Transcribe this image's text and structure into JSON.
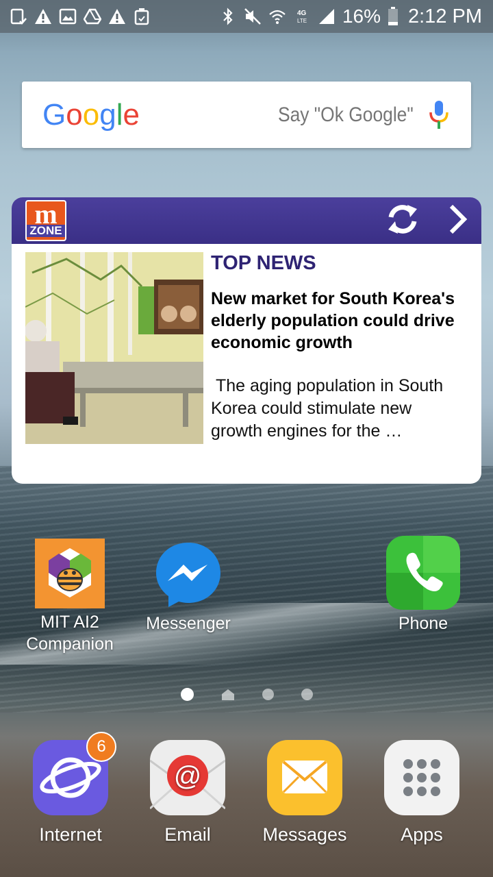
{
  "status_bar": {
    "left_icons": [
      "screenshot-icon",
      "warning-icon",
      "image-icon",
      "drive-icon",
      "warning-icon",
      "cleaner-icon"
    ],
    "right_icons": [
      "bluetooth-icon",
      "mute-icon",
      "wifi-icon",
      "4g-lte-icon",
      "signal-icon"
    ],
    "battery_percent": "16%",
    "time": "2:12 PM"
  },
  "google_widget": {
    "logo_letters": [
      "G",
      "o",
      "o",
      "g",
      "l",
      "e"
    ],
    "hint": "Say \"Ok Google\""
  },
  "news_widget": {
    "logo_m": "m",
    "logo_zone": "ZONE",
    "kicker": "TOP NEWS",
    "headline": "New market for South Korea's elderly population could drive economic growth",
    "summary": " The aging population in South Korea could stimulate new growth engines for the …"
  },
  "home_apps": [
    {
      "label_line1": "MIT AI2",
      "label_line2": "Companion",
      "icon": "mit-ai2-icon"
    },
    {
      "label_line1": "Messenger",
      "label_line2": "",
      "icon": "messenger-icon"
    },
    {
      "label_line1": "Phone",
      "label_line2": "",
      "icon": "phone-icon"
    }
  ],
  "page_indicator": {
    "pages": 4,
    "active_index": 0
  },
  "dock": [
    {
      "label": "Internet",
      "icon": "internet-icon",
      "badge": "6"
    },
    {
      "label": "Email",
      "icon": "email-icon",
      "badge": ""
    },
    {
      "label": "Messages",
      "icon": "messages-icon",
      "badge": ""
    },
    {
      "label": "Apps",
      "icon": "apps-grid-icon",
      "badge": ""
    }
  ],
  "colors": {
    "news_header": "#3a2f86",
    "news_kicker": "#2e2373",
    "badge": "#f07c20"
  }
}
